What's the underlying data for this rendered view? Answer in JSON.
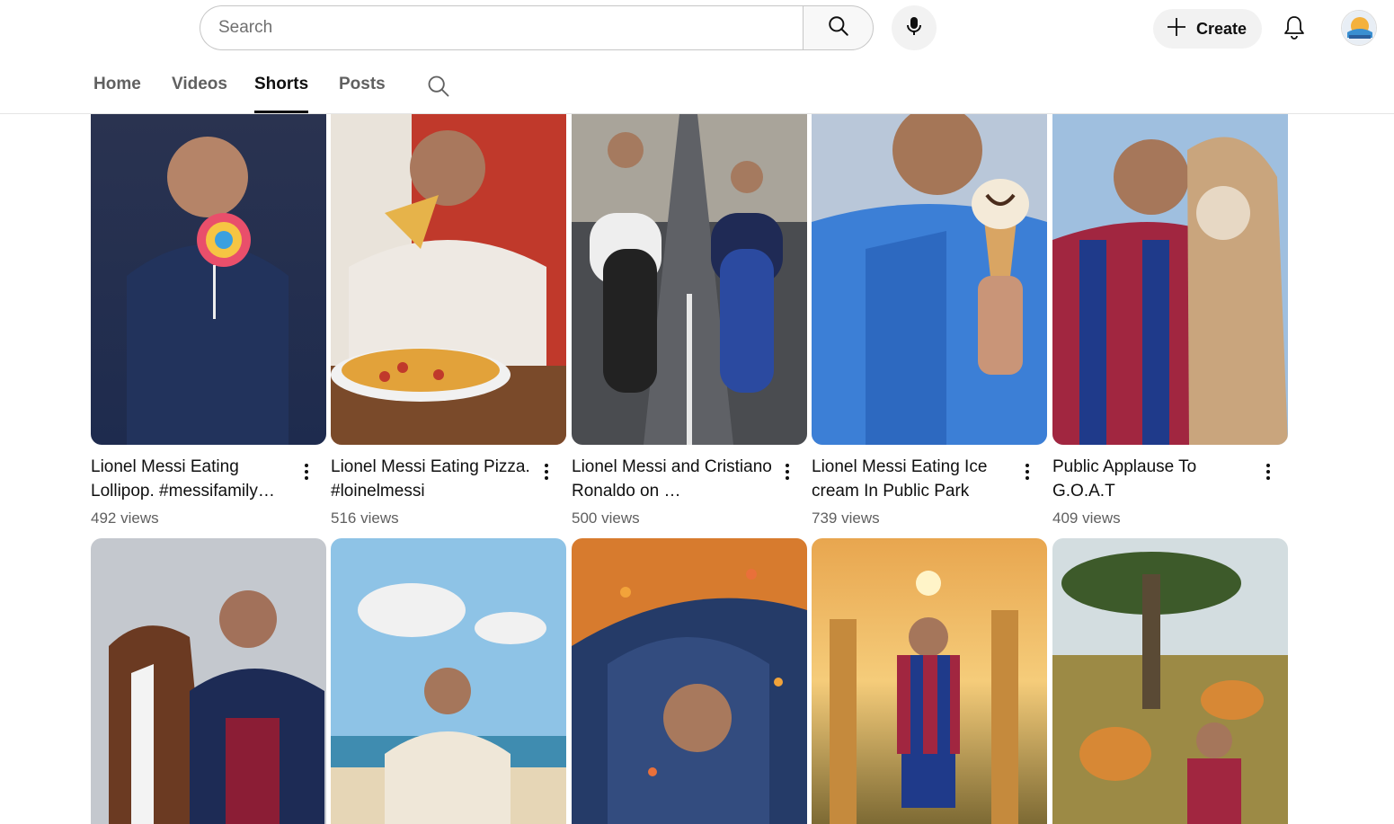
{
  "search": {
    "placeholder": "Search"
  },
  "header": {
    "create_label": "Create"
  },
  "tabs": [
    {
      "label": "Home",
      "active": false
    },
    {
      "label": "Videos",
      "active": false
    },
    {
      "label": "Shorts",
      "active": true
    },
    {
      "label": "Posts",
      "active": false
    }
  ],
  "icons": {
    "search": "search-icon",
    "mic": "microphone-icon",
    "create": "plus-icon",
    "notifications": "bell-icon",
    "more": "more-vertical-icon"
  },
  "shorts_row1": [
    {
      "title": "Lionel Messi Eating Lollipop. #messifamily…",
      "views": "492 views",
      "bg": [
        "#1f2c4a",
        "#3d4d75"
      ]
    },
    {
      "title": "Lionel Messi Eating Pizza. #loinelmessi",
      "views": "516 views",
      "bg": [
        "#b8412f",
        "#e7d8c8"
      ]
    },
    {
      "title": "Lionel Messi and Cristiano Ronaldo on …",
      "views": "500 views",
      "bg": [
        "#8a8c8c",
        "#3d3f42"
      ]
    },
    {
      "title": "Lionel Messi Eating Ice cream In Public Park",
      "views": "739 views",
      "bg": [
        "#3a6fc2",
        "#9fb6d6"
      ]
    },
    {
      "title": "Public Applause To G.O.A.T",
      "views": "409 views",
      "bg": [
        "#8aa9c9",
        "#7a2538"
      ]
    }
  ],
  "shorts_row2": [
    {
      "bg": [
        "#c9ccd1",
        "#5a2a2a"
      ]
    },
    {
      "bg": [
        "#8fc1e3",
        "#e5d4b5"
      ]
    },
    {
      "bg": [
        "#d57a2d",
        "#2b3f6b"
      ]
    },
    {
      "bg": [
        "#f0b35a",
        "#6a5a2d"
      ]
    },
    {
      "bg": [
        "#cfdbe0",
        "#8b7a3b"
      ]
    }
  ]
}
